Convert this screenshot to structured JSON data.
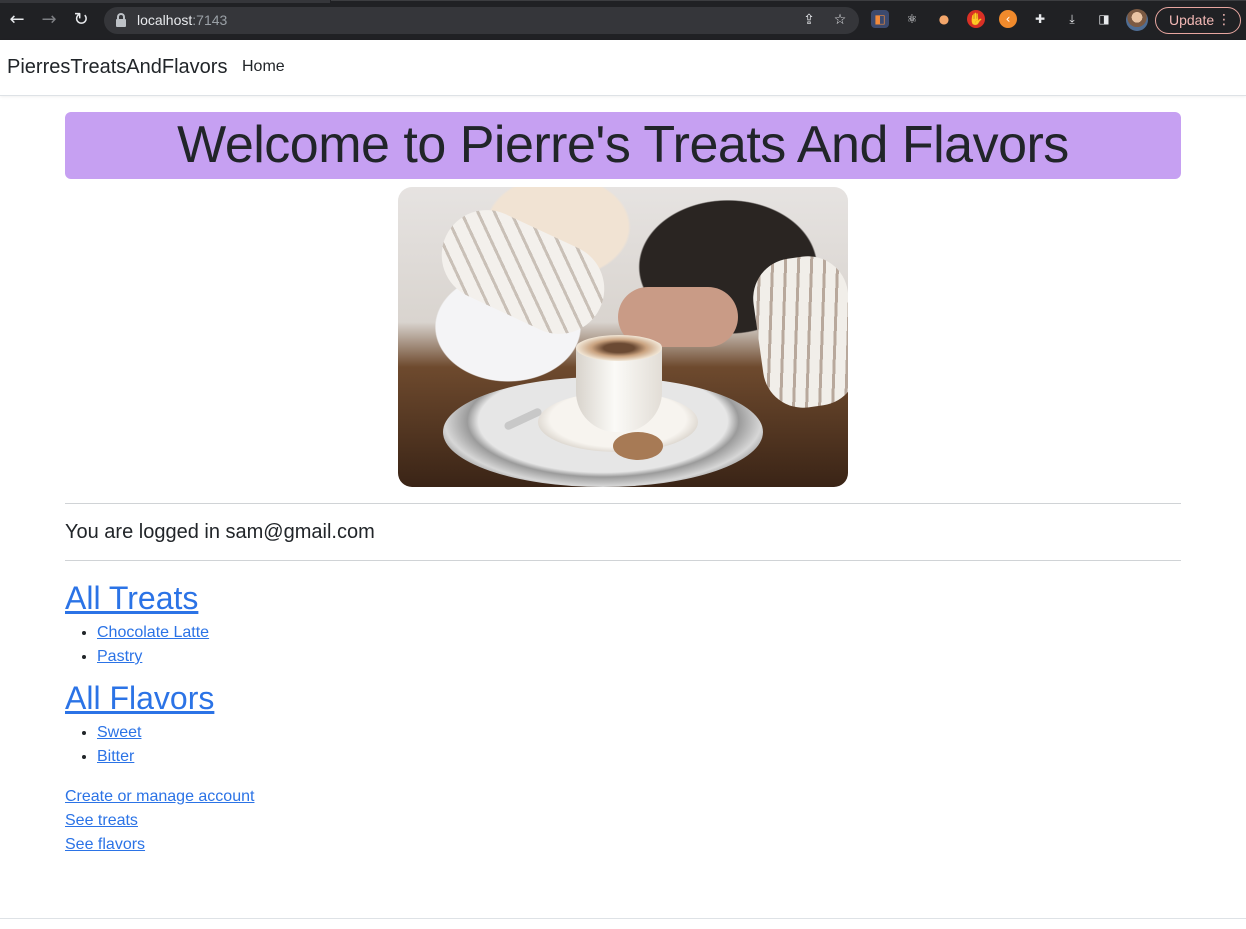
{
  "browser": {
    "url_host": "localhost",
    "url_port": ":7143",
    "update_label": "Update"
  },
  "navbar": {
    "brand": "PierresTreatsAndFlavors",
    "home_label": "Home"
  },
  "hero": {
    "title": "Welcome to Pierre's Treats And Flavors",
    "background_color": "#c6a0f2"
  },
  "image": {
    "icon": "coffee-cup-photo"
  },
  "login": {
    "text": "You are logged in sam@gmail.com"
  },
  "treats": {
    "heading": "All Treats",
    "items": [
      "Chocolate Latte",
      "Pastry"
    ]
  },
  "flavors": {
    "heading": "All Flavors",
    "items": [
      "Sweet",
      "Bitter"
    ]
  },
  "links": {
    "account": "Create or manage account",
    "treats": "See treats",
    "flavors": "See flavors"
  },
  "colors": {
    "link": "#2b73e6",
    "chrome_bg": "#202124"
  }
}
